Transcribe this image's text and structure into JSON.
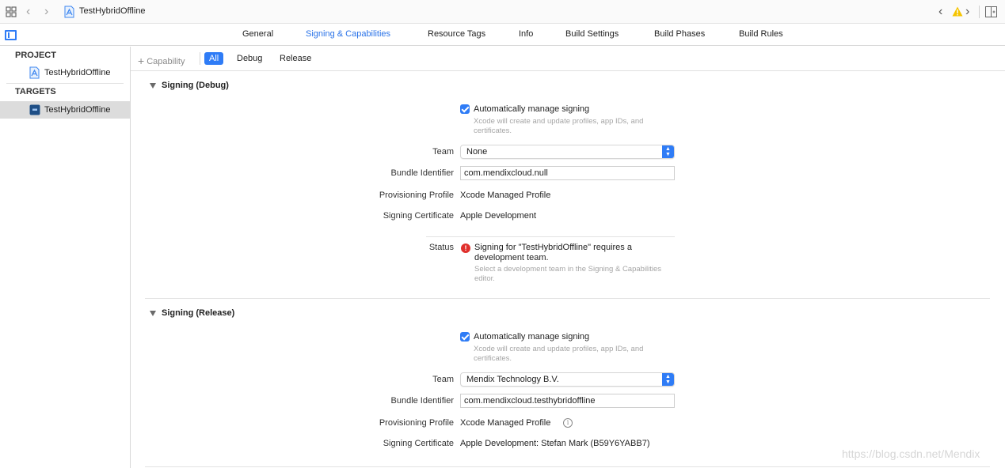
{
  "window": {
    "project_title": "TestHybridOffline"
  },
  "icons": {
    "grid": "grid-icon",
    "back": "chevron-left-icon",
    "forward": "chevron-right-icon",
    "project": "xcode-project-icon",
    "warning": "warning-icon",
    "split": "split-editor-icon",
    "sidebar_toggle": "sidebar-toggle-icon"
  },
  "colors": {
    "accent": "#2f7cf6",
    "error": "#e0302c",
    "warning": "#f5c400"
  },
  "tabs": [
    "General",
    "Signing & Capabilities",
    "Resource Tags",
    "Info",
    "Build Settings",
    "Build Phases",
    "Build Rules"
  ],
  "active_tab": "Signing & Capabilities",
  "sidebar": {
    "project_header": "PROJECT",
    "project_item": "TestHybridOffline",
    "targets_header": "TARGETS",
    "target_item": "TestHybridOffline"
  },
  "filter": {
    "add_capability": "Capability",
    "segments": [
      "All",
      "Debug",
      "Release"
    ],
    "active_segment": "All"
  },
  "debug": {
    "title": "Signing (Debug)",
    "auto_manage": "Automatically manage signing",
    "auto_manage_hint": "Xcode will create and update profiles, app IDs, and certificates.",
    "team_label": "Team",
    "team_value": "None",
    "bundle_label": "Bundle Identifier",
    "bundle_value": "com.mendixcloud.null",
    "profile_label": "Provisioning Profile",
    "profile_value": "Xcode Managed Profile",
    "cert_label": "Signing Certificate",
    "cert_value": "Apple Development",
    "status_label": "Status",
    "status_text": "Signing for \"TestHybridOffline\" requires a development team.",
    "status_hint": "Select a development team in the Signing & Capabilities editor."
  },
  "release": {
    "title": "Signing (Release)",
    "auto_manage": "Automatically manage signing",
    "auto_manage_hint": "Xcode will create and update profiles, app IDs, and certificates.",
    "team_label": "Team",
    "team_value": "Mendix Technology B.V.",
    "bundle_label": "Bundle Identifier",
    "bundle_value": "com.mendixcloud.testhybridoffline",
    "profile_label": "Provisioning Profile",
    "profile_value": "Xcode Managed Profile",
    "cert_label": "Signing Certificate",
    "cert_value": "Apple Development: Stefan Mark (B59Y6YABB7)"
  },
  "watermark": "https://blog.csdn.net/Mendix"
}
